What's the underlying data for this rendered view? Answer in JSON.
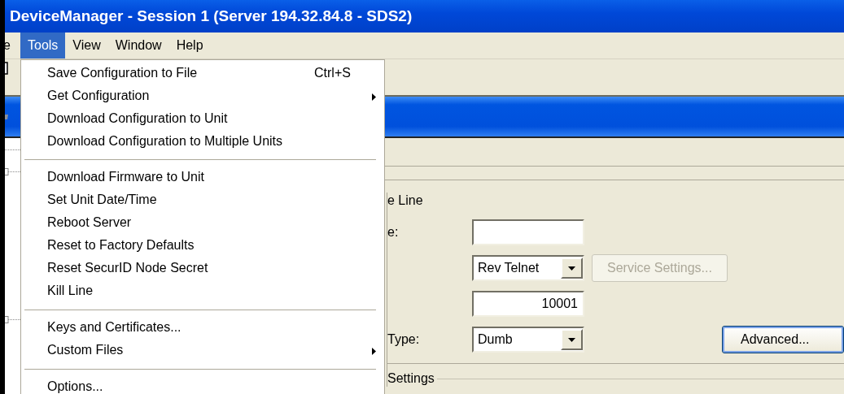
{
  "window": {
    "title": "DeviceManager - Session 1 (Server 194.32.84.8 - SDS2)"
  },
  "menubar": [
    {
      "label": "e",
      "selected": false
    },
    {
      "label": "Tools",
      "selected": true
    },
    {
      "label": "View",
      "selected": false
    },
    {
      "label": "Window",
      "selected": false
    },
    {
      "label": "Help",
      "selected": false
    }
  ],
  "tools_menu": [
    {
      "kind": "item",
      "label": "Save Configuration to File",
      "shortcut": "Ctrl+S"
    },
    {
      "kind": "submenu",
      "label": "Get Configuration"
    },
    {
      "kind": "item",
      "label": "Download Configuration to Unit"
    },
    {
      "kind": "item",
      "label": "Download Configuration to Multiple Units"
    },
    {
      "kind": "separator"
    },
    {
      "kind": "item",
      "label": "Download Firmware to Unit"
    },
    {
      "kind": "item",
      "label": "Set Unit Date/Time"
    },
    {
      "kind": "item",
      "label": "Reboot Server"
    },
    {
      "kind": "item",
      "label": "Reset to Factory Defaults"
    },
    {
      "kind": "item",
      "label": "Reset SecurID Node Secret"
    },
    {
      "kind": "item",
      "label": "Kill Line"
    },
    {
      "kind": "separator"
    },
    {
      "kind": "item",
      "label": "Keys and Certificates..."
    },
    {
      "kind": "submenu",
      "label": "Custom Files"
    },
    {
      "kind": "separator"
    },
    {
      "kind": "item",
      "label": "Options..."
    }
  ],
  "form": {
    "section_label": "e Line",
    "name_label": "e:",
    "service": {
      "value": "Rev Telnet"
    },
    "service_settings_button": {
      "label": "Service Settings...",
      "disabled": true
    },
    "port": {
      "value": "10001"
    },
    "terminal": {
      "label": "Type:",
      "value": "Dumb"
    },
    "advanced_button": {
      "label": "Advanced..."
    },
    "settings_group": {
      "label": "Settings"
    }
  }
}
